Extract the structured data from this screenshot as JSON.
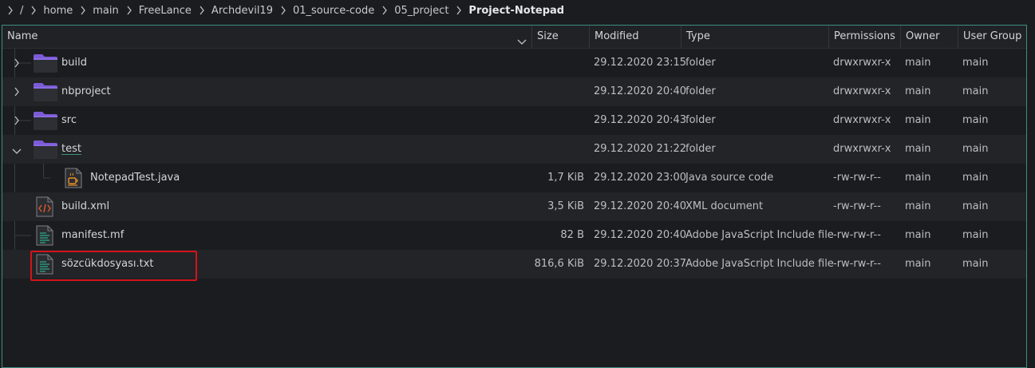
{
  "breadcrumb": {
    "items": [
      "/",
      "home",
      "main",
      "FreeLance",
      "Archdevil19",
      "01_source-code",
      "05_project",
      "Project-Notepad"
    ]
  },
  "columns": {
    "name": "Name",
    "size": "Size",
    "modified": "Modified",
    "type": "Type",
    "permissions": "Permissions",
    "owner": "Owner",
    "group": "User Group"
  },
  "rows": [
    {
      "name": "build",
      "size": "",
      "modified": "29.12.2020 23:15",
      "type": "folder",
      "permissions": "drwxrwxr-x",
      "owner": "main",
      "group": "main",
      "icon": "folder-icon",
      "expanded": false,
      "depth": 0
    },
    {
      "name": "nbproject",
      "size": "",
      "modified": "29.12.2020 20:40",
      "type": "folder",
      "permissions": "drwxrwxr-x",
      "owner": "main",
      "group": "main",
      "icon": "folder-icon",
      "expanded": false,
      "depth": 0
    },
    {
      "name": "src",
      "size": "",
      "modified": "29.12.2020 20:43",
      "type": "folder",
      "permissions": "drwxrwxr-x",
      "owner": "main",
      "group": "main",
      "icon": "folder-icon",
      "expanded": false,
      "depth": 0
    },
    {
      "name": "test",
      "size": "",
      "modified": "29.12.2020 21:22",
      "type": "folder",
      "permissions": "drwxrwxr-x",
      "owner": "main",
      "group": "main",
      "icon": "folder-icon",
      "expanded": true,
      "depth": 0
    },
    {
      "name": "NotepadTest.java",
      "size": "1,7 KiB",
      "modified": "29.12.2020 23:00",
      "type": "Java source code",
      "permissions": "-rw-rw-r--",
      "owner": "main",
      "group": "main",
      "icon": "java-file-icon",
      "depth": 1
    },
    {
      "name": "build.xml",
      "size": "3,5 KiB",
      "modified": "29.12.2020 20:40",
      "type": "XML document",
      "permissions": "-rw-rw-r--",
      "owner": "main",
      "group": "main",
      "icon": "xml-file-icon",
      "depth": 0
    },
    {
      "name": "manifest.mf",
      "size": "82 B",
      "modified": "29.12.2020 20:40",
      "type": "Adobe JavaScript Include file",
      "permissions": "-rw-rw-r--",
      "owner": "main",
      "group": "main",
      "icon": "text-file-icon",
      "depth": 0
    },
    {
      "name": "sözcükdosyası.txt",
      "size": "816,6 KiB",
      "modified": "29.12.2020 20:37",
      "type": "Adobe JavaScript Include file",
      "permissions": "-rw-rw-r--",
      "owner": "main",
      "group": "main",
      "icon": "text-file-icon",
      "depth": 0,
      "highlighted": true
    }
  ],
  "colors": {
    "accent": "#3d8e82",
    "highlight": "#d3141b",
    "folder": "#7b5bd6"
  }
}
